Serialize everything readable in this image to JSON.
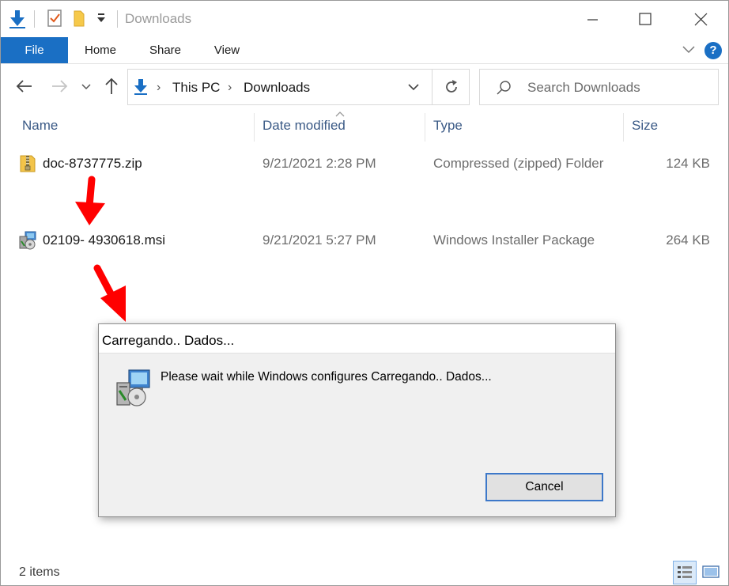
{
  "window": {
    "title": "Downloads"
  },
  "ribbon": {
    "tabs": [
      {
        "label": "File",
        "active": true
      },
      {
        "label": "Home",
        "active": false
      },
      {
        "label": "Share",
        "active": false
      },
      {
        "label": "View",
        "active": false
      }
    ],
    "help_label": "?"
  },
  "address": {
    "crumbs": [
      "This PC",
      "Downloads"
    ]
  },
  "search": {
    "placeholder": "Search Downloads"
  },
  "columns": {
    "name": "Name",
    "date": "Date modified",
    "type": "Type",
    "size": "Size"
  },
  "files": [
    {
      "name": "doc-8737775.zip",
      "date": "9/21/2021 2:28 PM",
      "type": "Compressed (zipped) Folder",
      "size": "124 KB",
      "icon": "zip-folder-icon"
    },
    {
      "name": "02109- 4930618.msi",
      "date": "9/21/2021 5:27 PM",
      "type": "Windows Installer Package",
      "size": "264 KB",
      "icon": "msi-installer-icon"
    }
  ],
  "dialog": {
    "title": "Carregando.. Dados...",
    "message": "Please wait while Windows configures Carregando.. Dados...",
    "cancel_label": "Cancel"
  },
  "status": {
    "item_count": "2 items"
  },
  "colors": {
    "accent": "#1a6fc4",
    "annotation_arrow": "#ff0000",
    "column_header": "#3b5a86"
  }
}
